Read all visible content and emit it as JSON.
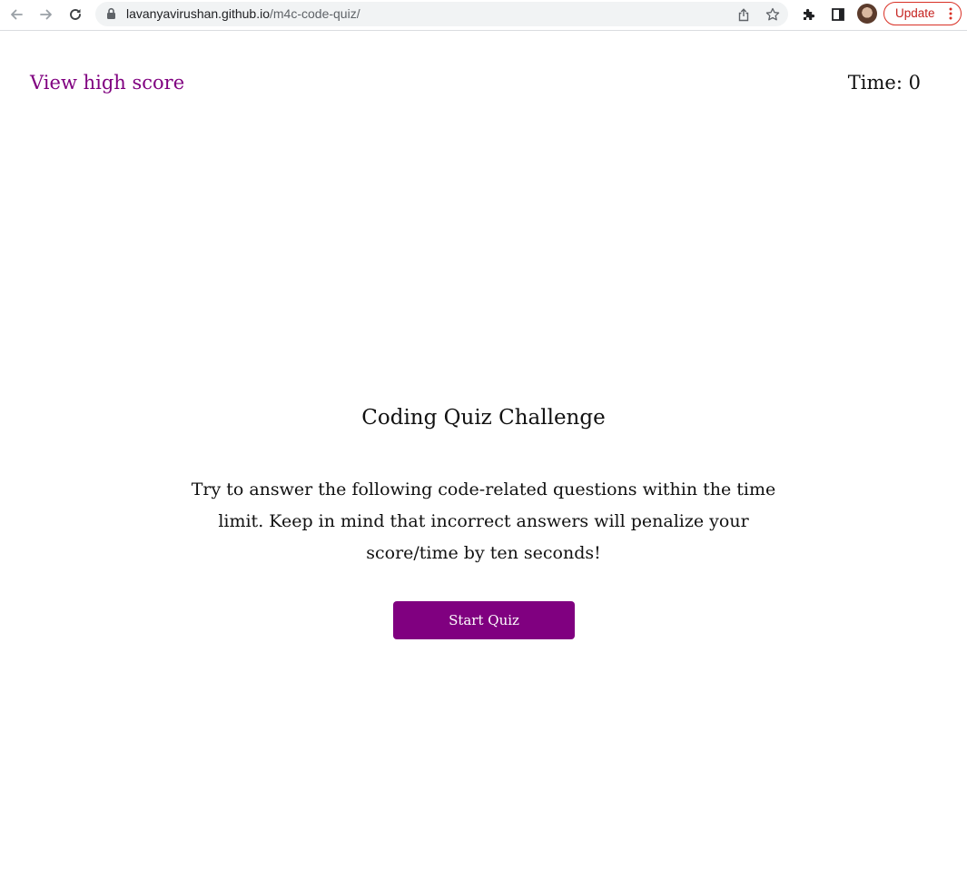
{
  "browser": {
    "url_host": "lavanyavirushan.github.io",
    "url_path": "/m4c-code-quiz/",
    "update_label": "Update",
    "icons": {
      "back": "arrow-left-icon",
      "forward": "arrow-right-icon",
      "reload": "reload-icon",
      "lock": "lock-icon",
      "share": "share-icon",
      "bookmark": "star-icon",
      "extensions": "puzzle-icon",
      "side_panel": "side-panel-icon",
      "profile": "avatar",
      "menu": "kebab-menu-icon"
    }
  },
  "header": {
    "highscore_label": "View high score",
    "timer_label": "Time: ",
    "timer_value": "0"
  },
  "main": {
    "title": "Coding Quiz Challenge",
    "description": "Try to answer the following code-related questions within the time limit. Keep in mind that incorrect answers will penalize your score/time by ten seconds!",
    "start_label": "Start Quiz"
  },
  "colors": {
    "accent": "#800080",
    "update_red": "#d93025"
  }
}
